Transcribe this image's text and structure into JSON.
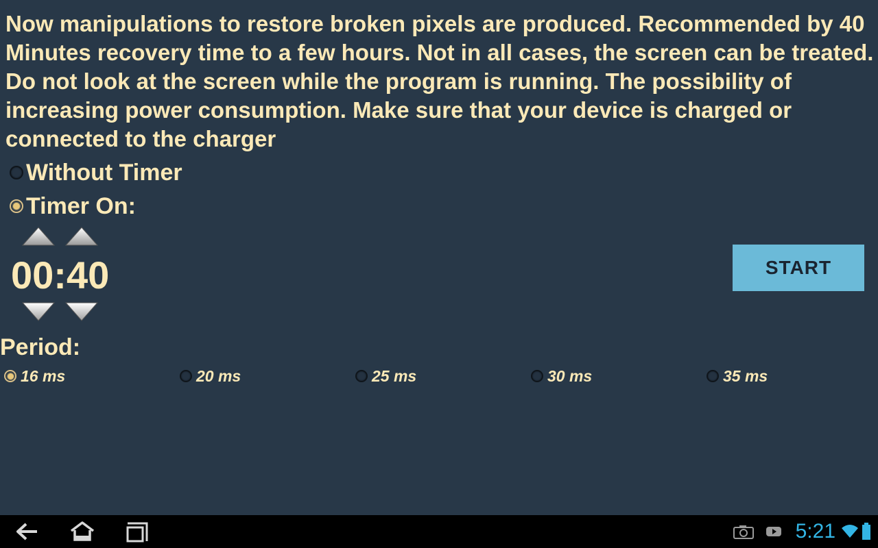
{
  "description": "Now manipulations to restore broken pixels are produced. Recommended by 40 Minutes recovery time to a few hours. Not in all cases, the screen can be treated. Do not look at the screen while the program is running. The possibility of increasing power consumption. Make sure that your device is charged or connected to the charger",
  "mode": {
    "without_timer_label": "Without Timer",
    "timer_on_label": "Timer On:",
    "selected": "timer_on"
  },
  "timer": {
    "hours": "00",
    "separator": ":",
    "minutes": "40"
  },
  "start_label": "START",
  "period": {
    "label": "Period:",
    "options": [
      "16 ms",
      "20 ms",
      "25 ms",
      "30 ms",
      "35 ms"
    ],
    "selected_index": 0
  },
  "status_bar": {
    "time": "5:21",
    "icons": [
      "camera-icon",
      "youtube-icon",
      "wifi-icon",
      "battery-icon"
    ]
  },
  "navbar": {
    "icons": [
      "back-icon",
      "home-icon",
      "recent-apps-icon"
    ]
  },
  "colors": {
    "background": "#283848",
    "text": "#fbe9b7",
    "accent": "#6bbad8",
    "clock": "#33b5e5"
  }
}
